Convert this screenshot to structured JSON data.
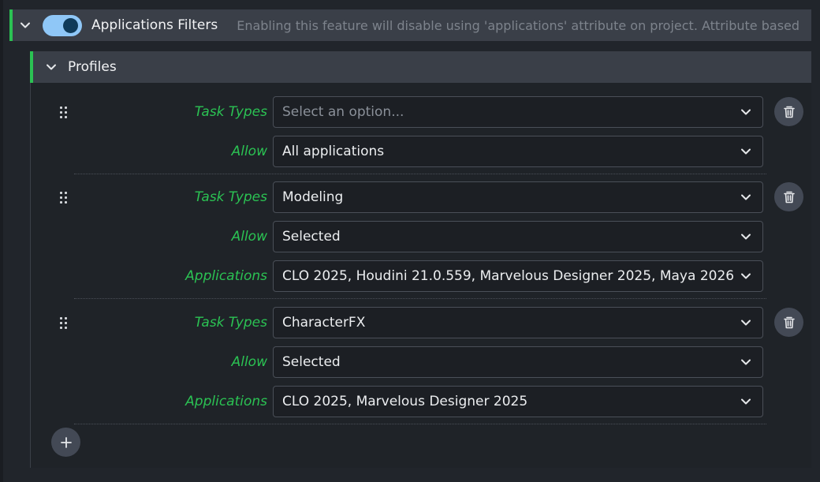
{
  "header": {
    "title": "Applications Filters",
    "description": "Enabling this feature will disable using 'applications' attribute on project. Attribute based",
    "toggle_on": true,
    "accent_color": "#2bc253",
    "toggle_color": "#8fc7f7"
  },
  "profiles": {
    "title": "Profiles",
    "items": [
      {
        "task_types_label": "Task Types",
        "task_types_value": "Select an option...",
        "allow_label": "Allow",
        "allow_value": "All applications"
      },
      {
        "task_types_label": "Task Types",
        "task_types_value": "Modeling",
        "allow_label": "Allow",
        "allow_value": "Selected",
        "applications_label": "Applications",
        "applications_value": "CLO 2025, Houdini 21.0.559, Marvelous Designer 2025, Maya 2026"
      },
      {
        "task_types_label": "Task Types",
        "task_types_value": "CharacterFX",
        "allow_label": "Allow",
        "allow_value": "Selected",
        "applications_label": "Applications",
        "applications_value": "CLO 2025, Marvelous Designer 2025"
      }
    ]
  },
  "icons": {
    "collapse": "chevron-down-icon",
    "drag": "drag-handle-icon",
    "delete": "trash-icon",
    "add": "plus-icon"
  }
}
